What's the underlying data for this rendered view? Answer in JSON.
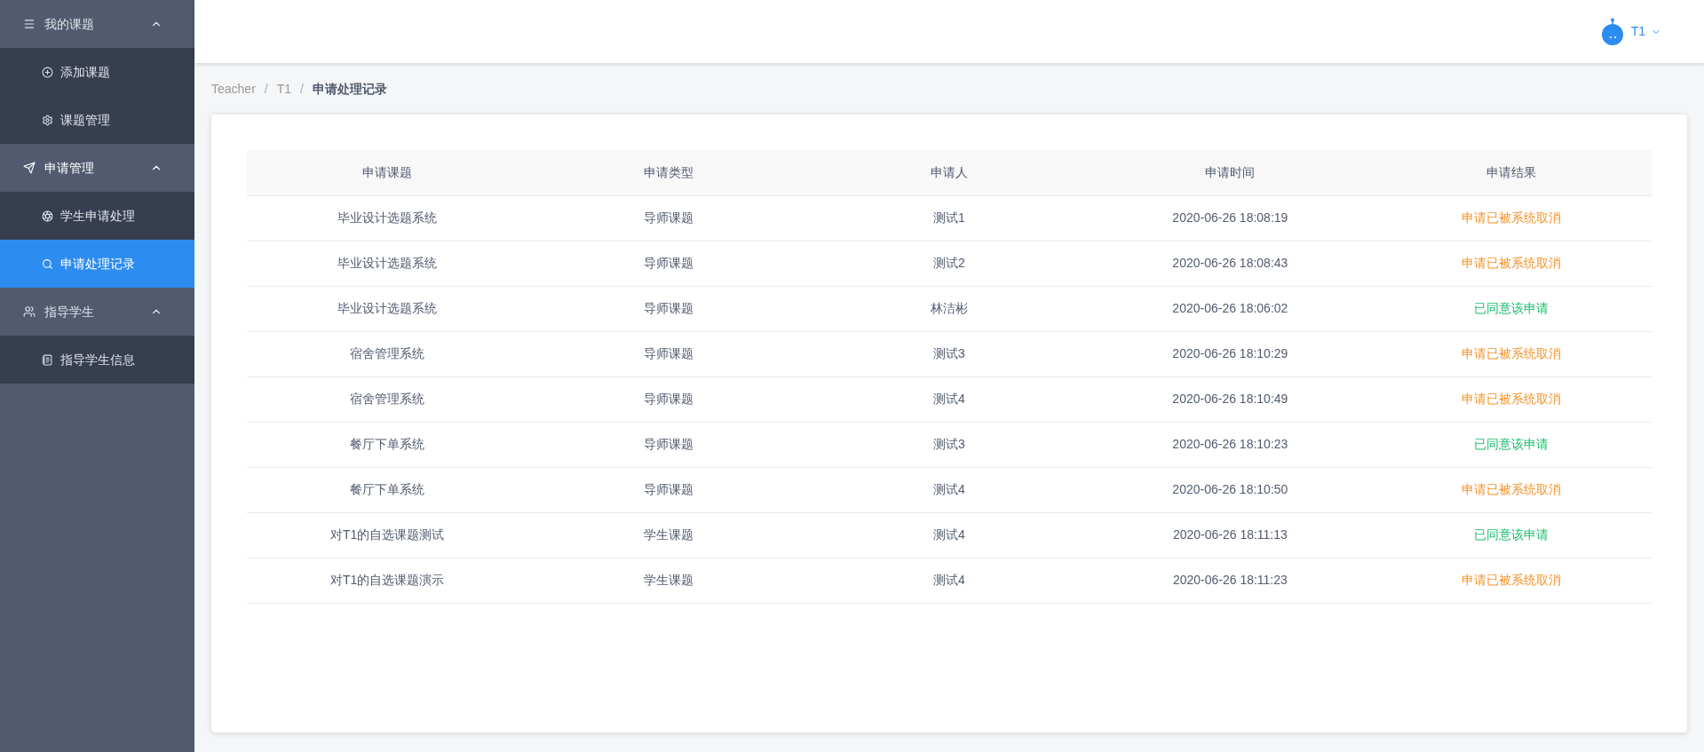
{
  "sidebar": {
    "groups": [
      {
        "label": "我的课题",
        "expanded": true,
        "items": [
          {
            "label": "添加课题",
            "selected": false
          },
          {
            "label": "课题管理",
            "selected": false
          }
        ]
      },
      {
        "label": "申请管理",
        "expanded": true,
        "items": [
          {
            "label": "学生申请处理",
            "selected": false
          },
          {
            "label": "申请处理记录",
            "selected": true
          }
        ]
      },
      {
        "label": "指导学生",
        "expanded": true,
        "items": [
          {
            "label": "指导学生信息",
            "selected": false
          }
        ]
      }
    ]
  },
  "header": {
    "user": "T1"
  },
  "breadcrumb": {
    "separator": "/",
    "items": [
      "Teacher",
      "T1",
      "申请处理记录"
    ]
  },
  "table": {
    "columns": [
      "申请课题",
      "申请类型",
      "申请人",
      "申请时间",
      "申请结果"
    ],
    "rows": [
      {
        "cells": [
          "毕业设计选题系统",
          "导师课题",
          "测试1",
          "2020-06-26 18:08:19",
          "申请已被系统取消"
        ],
        "kind": "cancelled"
      },
      {
        "cells": [
          "毕业设计选题系统",
          "导师课题",
          "测试2",
          "2020-06-26 18:08:43",
          "申请已被系统取消"
        ],
        "kind": "cancelled"
      },
      {
        "cells": [
          "毕业设计选题系统",
          "导师课题",
          "林洁彬",
          "2020-06-26 18:06:02",
          "已同意该申请"
        ],
        "kind": "agreed"
      },
      {
        "cells": [
          "宿舍管理系统",
          "导师课题",
          "测试3",
          "2020-06-26 18:10:29",
          "申请已被系统取消"
        ],
        "kind": "cancelled"
      },
      {
        "cells": [
          "宿舍管理系统",
          "导师课题",
          "测试4",
          "2020-06-26 18:10:49",
          "申请已被系统取消"
        ],
        "kind": "cancelled"
      },
      {
        "cells": [
          "餐厅下单系统",
          "导师课题",
          "测试3",
          "2020-06-26 18:10:23",
          "已同意该申请"
        ],
        "kind": "agreed"
      },
      {
        "cells": [
          "餐厅下单系统",
          "导师课题",
          "测试4",
          "2020-06-26 18:10:50",
          "申请已被系统取消"
        ],
        "kind": "cancelled"
      },
      {
        "cells": [
          "对T1的自选课题测试",
          "学生课题",
          "测试4",
          "2020-06-26 18:11:13",
          "已同意该申请"
        ],
        "kind": "agreed"
      },
      {
        "cells": [
          "对T1的自选课题演示",
          "学生课题",
          "测试4",
          "2020-06-26 18:11:23",
          "申请已被系统取消"
        ],
        "kind": "cancelled"
      }
    ]
  }
}
